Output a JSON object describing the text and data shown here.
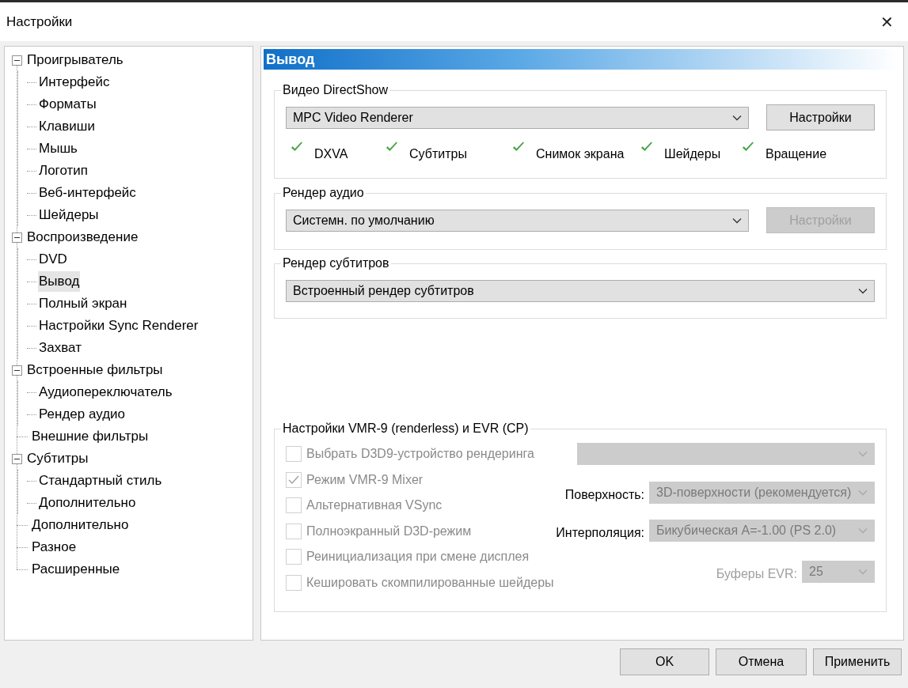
{
  "window": {
    "title": "Настройки",
    "close": "✕"
  },
  "tree": [
    {
      "label": "Проигрыватель",
      "expanded": true,
      "selected": false,
      "children": [
        {
          "label": "Интерфейс",
          "selected": false
        },
        {
          "label": "Форматы",
          "selected": false
        },
        {
          "label": "Клавиши",
          "selected": false
        },
        {
          "label": "Мышь",
          "selected": false
        },
        {
          "label": "Логотип",
          "selected": false
        },
        {
          "label": "Веб-интерфейс",
          "selected": false
        },
        {
          "label": "Шейдеры",
          "selected": false
        }
      ]
    },
    {
      "label": "Воспроизведение",
      "expanded": true,
      "selected": false,
      "children": [
        {
          "label": "DVD",
          "selected": false
        },
        {
          "label": "Вывод",
          "selected": true
        },
        {
          "label": "Полный экран",
          "selected": false
        },
        {
          "label": "Настройки Sync Renderer",
          "selected": false
        },
        {
          "label": "Захват",
          "selected": false
        }
      ]
    },
    {
      "label": "Встроенные фильтры",
      "expanded": true,
      "selected": false,
      "children": [
        {
          "label": "Аудиопереключатель",
          "selected": false
        },
        {
          "label": "Рендер аудио",
          "selected": false
        }
      ]
    },
    {
      "label": "Внешние фильтры",
      "selected": false
    },
    {
      "label": "Субтитры",
      "expanded": true,
      "selected": false,
      "children": [
        {
          "label": "Стандартный стиль",
          "selected": false
        },
        {
          "label": "Дополнительно",
          "selected": false
        }
      ]
    },
    {
      "label": "Дополнительно",
      "selected": false
    },
    {
      "label": "Разное",
      "selected": false
    },
    {
      "label": "Расширенные",
      "selected": false
    }
  ],
  "page_title": "Вывод",
  "video": {
    "legend": "Видео DirectShow",
    "value": "MPC Video Renderer",
    "button": {
      "label": "Настройки",
      "disabled": false
    },
    "features": [
      {
        "label": "DXVA",
        "checked": true
      },
      {
        "label": "Субтитры",
        "checked": true
      },
      {
        "label": "Снимок экрана",
        "checked": true
      },
      {
        "label": "Шейдеры",
        "checked": true
      },
      {
        "label": "Вращение",
        "checked": true
      }
    ]
  },
  "audio": {
    "legend": "Рендер аудио",
    "value": "Системн. по умолчанию",
    "button": {
      "label": "Настройки",
      "disabled": true
    }
  },
  "subtitles": {
    "legend": "Рендер субтитров",
    "value": "Встроенный рендер субтитров"
  },
  "vmr": {
    "legend": "Настройки VMR-9 (renderless) и EVR (CP)",
    "checkboxes": [
      {
        "label": "Выбрать D3D9-устройство рендеринга",
        "checked": false,
        "disabled": true
      },
      {
        "label": "Режим VMR-9 Mixer",
        "checked": true,
        "disabled": true
      },
      {
        "label": "Альтернативная VSync",
        "checked": false,
        "disabled": true
      },
      {
        "label": "Полноэкранный D3D-режим",
        "checked": false,
        "disabled": true
      },
      {
        "label": "Реинициализация при смене дисплея",
        "checked": false,
        "disabled": true
      },
      {
        "label": "Кешировать скомпилированные шейдеры",
        "checked": false,
        "disabled": true
      }
    ],
    "selects": [
      {
        "kind": "device",
        "disabled": true
      },
      {
        "kind": "surface",
        "label": "Поверхность:",
        "label_disabled": false,
        "value": "3D-поверхности (рекомендуется)",
        "disabled": true
      },
      {
        "kind": "interpolation",
        "label": "Интерполяция:",
        "label_disabled": false,
        "value": "Бикубическая A=-1.00 (PS 2.0)",
        "disabled": true
      },
      {
        "kind": "buffers",
        "label": "Буферы EVR:",
        "label_disabled": true,
        "value": "25",
        "disabled": true
      }
    ]
  },
  "buttons": [
    {
      "label": "OK"
    },
    {
      "label": "Отмена"
    },
    {
      "label": "Применить"
    }
  ]
}
